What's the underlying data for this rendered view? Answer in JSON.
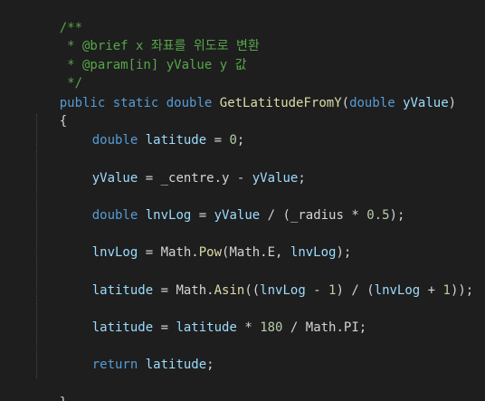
{
  "code": {
    "doc": {
      "open": "/**",
      "brief": " * @brief x 좌표를 위도로 변환",
      "param": " * @param[in] yValue y 값",
      "close": " */"
    },
    "signature": {
      "public": "public",
      "static": "static",
      "double": "double",
      "name": "GetLatitudeFromY",
      "open_paren": "(",
      "param_type": "double",
      "param_name": "yValue",
      "close_paren": ")"
    },
    "brace_open": "{",
    "brace_close": "}",
    "line1": {
      "type": "double",
      "var": "latitude",
      "eq": " = ",
      "val": "0",
      "end": ";"
    },
    "line2": {
      "lhs": "yValue",
      "eq": " = ",
      "centre": "_centre.y",
      "minus": " - ",
      "rhs": "yValue",
      "end": ";"
    },
    "line3": {
      "type": "double",
      "var": "lnvLog",
      "eq": " = ",
      "yvalue": "yValue",
      "div": " / (",
      "radius": "_radius",
      "mul": " * ",
      "num": "0.5",
      "end": ");"
    },
    "line4": {
      "var": "lnvLog",
      "eq": " = Math.",
      "fn": "Pow",
      "args_open": "(Math.E, ",
      "arg": "lnvLog",
      "end": ");"
    },
    "line5": {
      "var": "latitude",
      "eq": " = Math.",
      "fn": "Asin",
      "p1": "((",
      "a1": "lnvLog",
      "minus": " - ",
      "one1": "1",
      "mid": ") / (",
      "a2": "lnvLog",
      "plus": " + ",
      "one2": "1",
      "end": "));"
    },
    "line6": {
      "var": "latitude",
      "eq": " = ",
      "rhs": "latitude",
      "mul": " * ",
      "num": "180",
      "rest": " / Math.PI;"
    },
    "line7": {
      "kw": "return",
      "sp": " ",
      "var": "latitude",
      "end": ";"
    }
  }
}
